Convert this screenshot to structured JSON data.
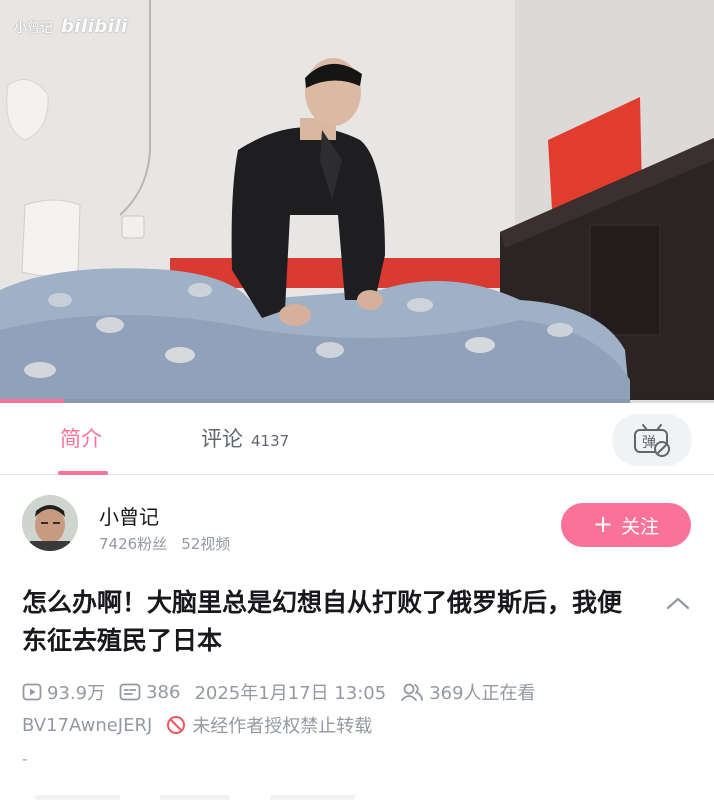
{
  "watermark": {
    "user": "小曾记",
    "logo": "bilibili"
  },
  "player": {
    "progress": 0.09
  },
  "tabs": {
    "intro": "简介",
    "comments": "评论",
    "comment_count": "4137",
    "danmaku_icon_char": "弹"
  },
  "uploader": {
    "name": "小曾记",
    "fans": "7426粉丝",
    "videos": "52视频",
    "follow_label": "关注"
  },
  "video": {
    "title": "怎么办啊！大脑里总是幻想自从打败了俄罗斯后，我便东征去殖民了日本",
    "views": "93.9万",
    "danmaku": "386",
    "date": "2025年1月17日 13:05",
    "watching": "369人正在看",
    "bvid": "BV17AwneJERJ",
    "rights": "未经作者授权禁止转载",
    "desc": "-"
  },
  "colors": {
    "accent": "#fb7299",
    "muted": "#9499a0"
  },
  "icons": [
    "play-count-icon",
    "danmaku-count-icon",
    "watching-icon",
    "no-repost-icon",
    "expand-chevron-icon",
    "danmaku-toggle-icon",
    "plus-icon"
  ]
}
